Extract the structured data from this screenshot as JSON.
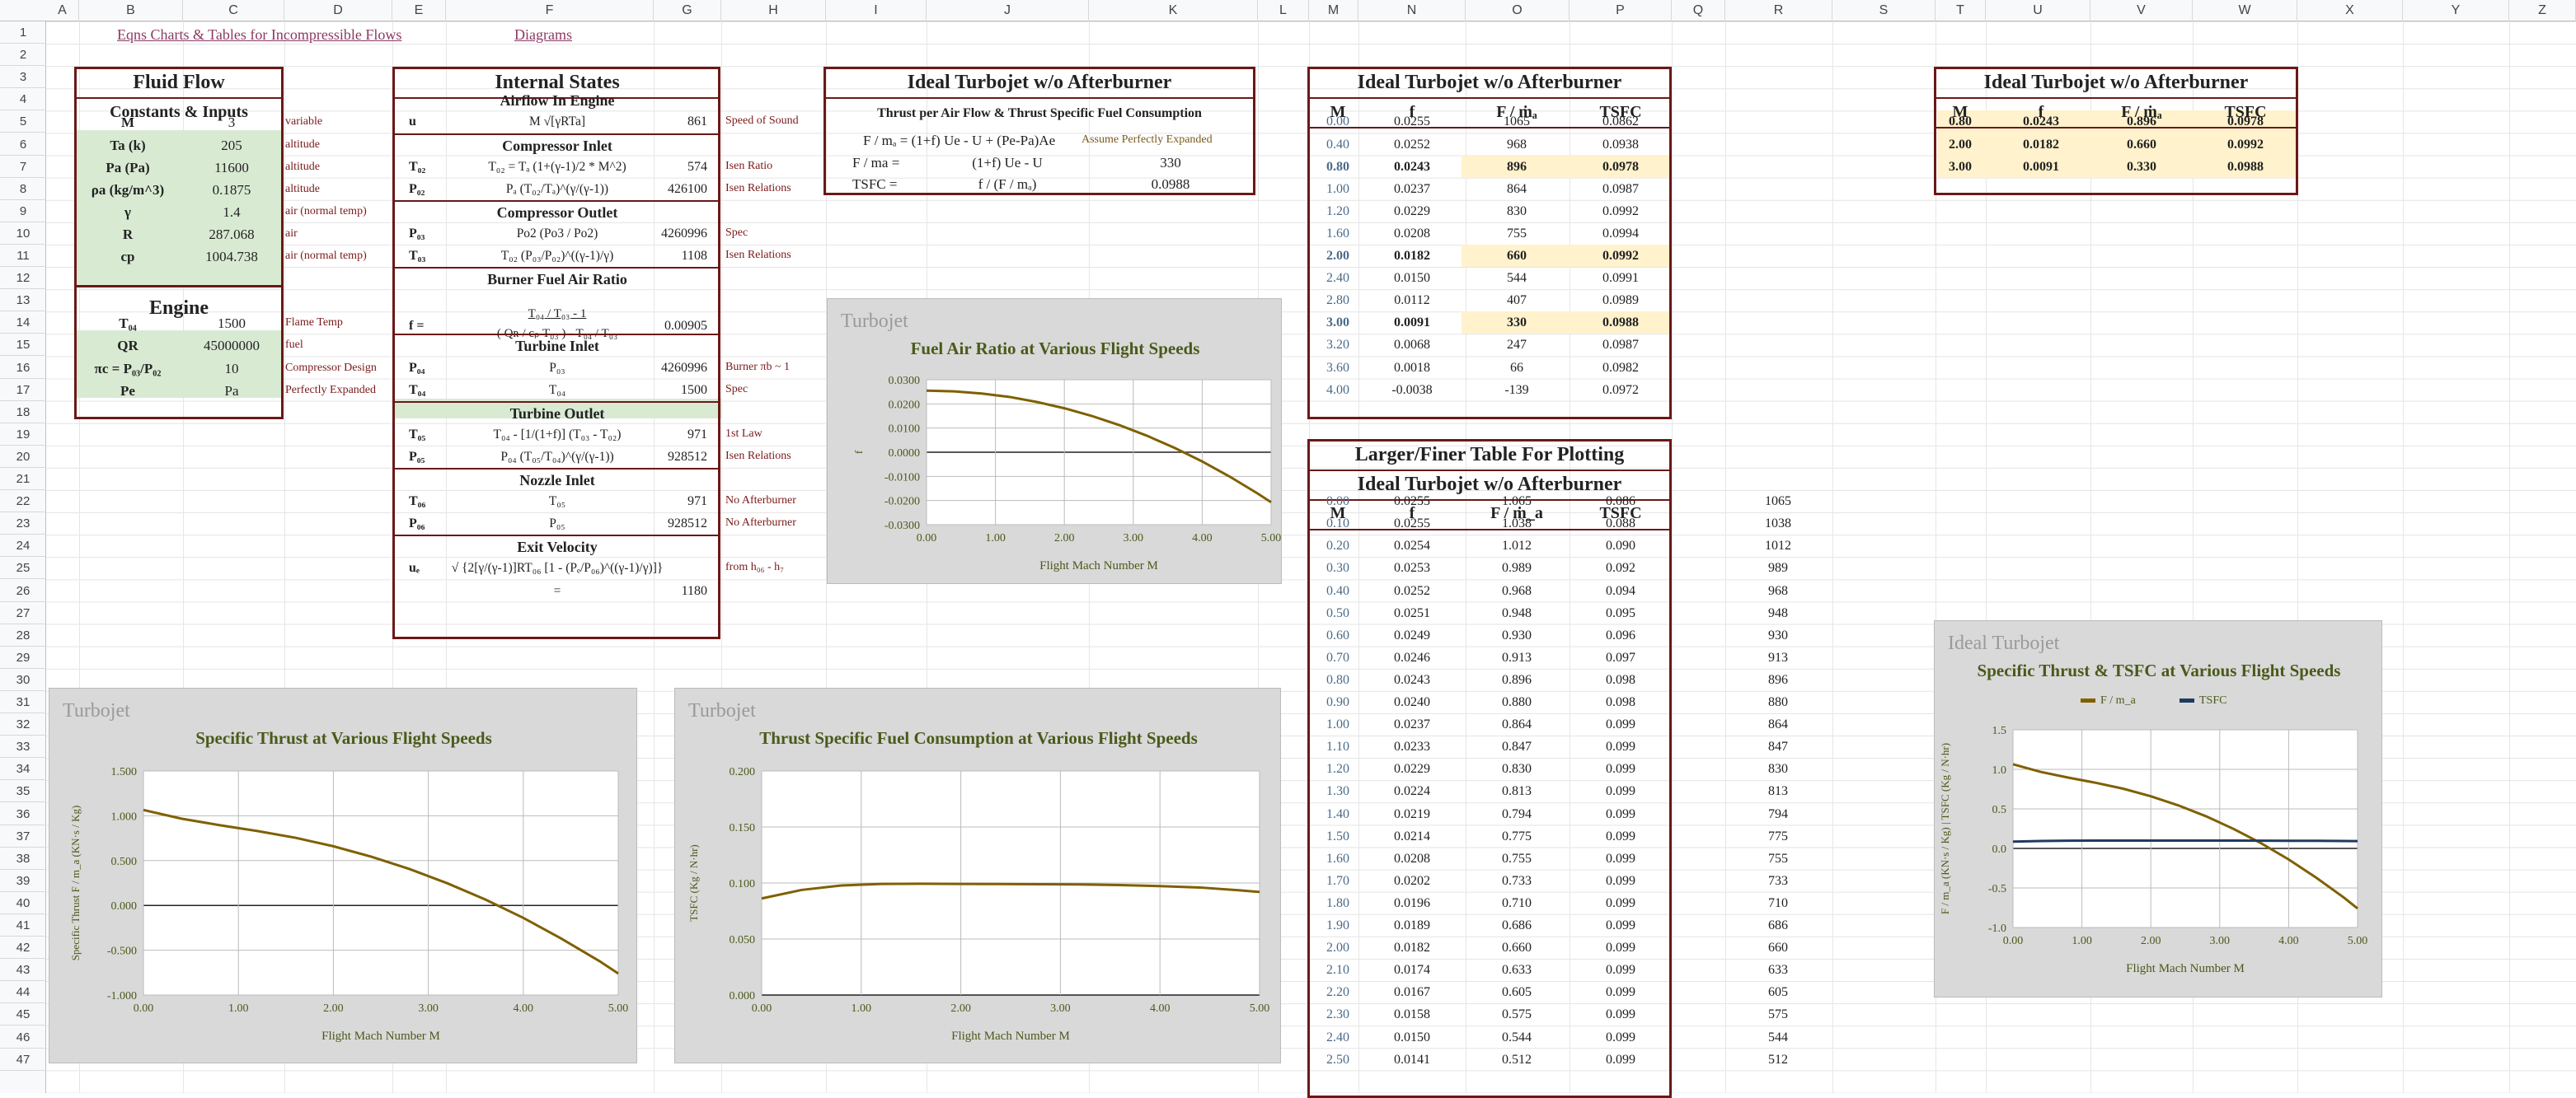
{
  "columns": [
    "A",
    "B",
    "C",
    "D",
    "E",
    "F",
    "G",
    "H",
    "I",
    "J",
    "K",
    "L",
    "M",
    "N",
    "O",
    "P",
    "Q",
    "R",
    "S",
    "T",
    "U",
    "V",
    "W",
    "X",
    "Y",
    "Z"
  ],
  "rows": [
    "1",
    "2",
    "3",
    "4",
    "5",
    "6",
    "7",
    "8",
    "9",
    "10",
    "11",
    "12",
    "13",
    "14",
    "15",
    "16",
    "17",
    "18",
    "19",
    "20",
    "21",
    "22",
    "23",
    "24",
    "25",
    "26",
    "27",
    "28",
    "29",
    "30",
    "31",
    "32",
    "33",
    "34",
    "35",
    "36",
    "37",
    "38",
    "39",
    "40",
    "41",
    "42",
    "43",
    "44",
    "45",
    "46",
    "47"
  ],
  "links": {
    "eqns": "Eqns Charts & Tables for Incompressible Flows",
    "diagrams": "Diagrams"
  },
  "fluid": {
    "title": "Fluid Flow",
    "subtitle": "Constants & Inputs",
    "rows": [
      {
        "name": "M",
        "value": "3",
        "note": "variable"
      },
      {
        "name": "Ta (k)",
        "value": "205",
        "note": "altitude"
      },
      {
        "name": "Pa (Pa)",
        "value": "11600",
        "note": "altitude"
      },
      {
        "name": "ρa (kg/m^3)",
        "value": "0.1875",
        "note": "altitude"
      },
      {
        "name": "γ",
        "value": "1.4",
        "note": "air (normal temp)"
      },
      {
        "name": "R",
        "value": "287.068",
        "note": "air"
      },
      {
        "name": "cp",
        "value": "1004.738",
        "note": "air (normal temp)"
      }
    ],
    "engine_title": "Engine",
    "engine_rows": [
      {
        "name": "T₀₄",
        "value": "1500",
        "note": "Flame Temp"
      },
      {
        "name": "QR",
        "value": "45000000",
        "note": "fuel"
      },
      {
        "name": "πc = P₀₃/P₀₂",
        "value": "10",
        "note": "Compressor Design"
      },
      {
        "name": "Pe",
        "value": "Pa",
        "note": "Perfectly Expanded"
      }
    ]
  },
  "internal": {
    "title": "Internal States",
    "sections": [
      {
        "head": "Airflow In Engine",
        "rows": [
          {
            "sym": "u",
            "eq": "M √[γRTa]",
            "val": "861",
            "note": "Speed of Sound"
          }
        ]
      },
      {
        "head": "Compressor Inlet",
        "rows": [
          {
            "sym": "T₀₂",
            "eq": "T₀₂ = Tₐ (1+(γ-1)/2 * M^2)",
            "val": "574",
            "note": "Isen Ratio"
          },
          {
            "sym": "P₀₂",
            "eq": "Pₐ (T₀₂/Tₐ)^(γ/(γ-1))",
            "val": "426100",
            "note": "Isen Relations"
          }
        ]
      },
      {
        "head": "Compressor Outlet",
        "rows": [
          {
            "sym": "P₀₃",
            "eq": "Po2 (Po3 / Po2)",
            "val": "4260996",
            "note": "Spec"
          },
          {
            "sym": "T₀₃",
            "eq": "T₀₂ (P₀₃/P₀₂)^((γ-1)/γ)",
            "val": "1108",
            "note": "Isen Relations"
          }
        ]
      },
      {
        "head": "Burner Fuel Air Ratio",
        "rows": [
          {
            "sym": "f =",
            "eq": "T₀₄ / T₀₃ - 1",
            "eq2": "( Qʀ / cₚ T₀₃ ) - T₀₄ / T₀₃",
            "val": "0.00905",
            "note": ""
          }
        ]
      },
      {
        "head": "Turbine Inlet",
        "rows": [
          {
            "sym": "P₀₄",
            "eq": "P₀₃",
            "val": "4260996",
            "note": "Burner πb ~ 1"
          },
          {
            "sym": "T₀₄",
            "eq": "T₀₄",
            "val": "1500",
            "note": "Spec"
          }
        ]
      },
      {
        "head": "Turbine Outlet",
        "rows": [
          {
            "sym": "T₀₅",
            "eq": "T₀₄ - [1/(1+f)] (T₀₃ - T₀₂)",
            "val": "971",
            "note": "1st Law"
          },
          {
            "sym": "P₀₅",
            "eq": "P₀₄ (T₀₅/T₀₄)^(γ/(γ-1))",
            "val": "928512",
            "note": "Isen Relations"
          }
        ]
      },
      {
        "head": "Nozzle Inlet",
        "rows": [
          {
            "sym": "T₀₆",
            "eq": "T₀₅",
            "val": "971",
            "note": "No Afterburner"
          },
          {
            "sym": "P₀₆",
            "eq": "P₀₅",
            "val": "928512",
            "note": "No Afterburner"
          }
        ]
      },
      {
        "head": "Exit Velocity",
        "rows": [
          {
            "sym": "uₑ",
            "eq": "√ {2[γ/(γ-1)]RT₀₆ [1 - (Pₑ/P₀₆)^((γ-1)/γ)]}",
            "val": "",
            "note": "from h₀₆ - h₇"
          },
          {
            "sym": "",
            "eq": "=",
            "val": "1180",
            "note": ""
          }
        ]
      }
    ]
  },
  "thrust_box": {
    "title": "Ideal Turbojet w/o Afterburner",
    "subtitle": "Thrust per Air Flow & Thrust Specific Fuel Consumption",
    "l1": "F / mₐ = (1+f) Ue  -  U  +  (Pe-Pa)Ae",
    "l1note": "Assume Perfectly Expanded",
    "l2a": "F / ma =",
    "l2b": "(1+f) Ue  -  U",
    "l2v": "330",
    "l3a": "TSFC =",
    "l3b": "f / (F / mₐ)",
    "l3v": "0.0988"
  },
  "table_main": {
    "title": "Ideal Turbojet w/o Afterburner",
    "headers": [
      "M",
      "f",
      "F / ṁₐ",
      "TSFC"
    ],
    "rows": [
      [
        "0.00",
        "0.0255",
        "1065",
        "0.0862"
      ],
      [
        "0.40",
        "0.0252",
        "968",
        "0.0938"
      ],
      [
        "0.80",
        "0.0243",
        "896",
        "0.0978"
      ],
      [
        "1.00",
        "0.0237",
        "864",
        "0.0987"
      ],
      [
        "1.20",
        "0.0229",
        "830",
        "0.0992"
      ],
      [
        "1.60",
        "0.0208",
        "755",
        "0.0994"
      ],
      [
        "2.00",
        "0.0182",
        "660",
        "0.0992"
      ],
      [
        "2.40",
        "0.0150",
        "544",
        "0.0991"
      ],
      [
        "2.80",
        "0.0112",
        "407",
        "0.0989"
      ],
      [
        "3.00",
        "0.0091",
        "330",
        "0.0988"
      ],
      [
        "3.20",
        "0.0068",
        "247",
        "0.0987"
      ],
      [
        "3.60",
        "0.0018",
        "66",
        "0.0982"
      ],
      [
        "4.00",
        "-0.0038",
        "-139",
        "0.0972"
      ]
    ]
  },
  "table_right": {
    "title": "Ideal Turbojet w/o Afterburner",
    "headers": [
      "M",
      "f",
      "F / ṁₐ",
      "TSFC"
    ],
    "rows": [
      [
        "0.80",
        "0.0243",
        "0.896",
        "0.0978"
      ],
      [
        "2.00",
        "0.0182",
        "0.660",
        "0.0992"
      ],
      [
        "3.00",
        "0.0091",
        "0.330",
        "0.0988"
      ]
    ]
  },
  "table_plot": {
    "title1": "Larger/Finer Table For Plotting",
    "title2": "Ideal Turbojet w/o Afterburner",
    "headers": [
      "M",
      "f",
      "F / ṁ_a",
      "TSFC"
    ],
    "rows": [
      [
        "0.00",
        "0.0255",
        "1.065",
        "0.086",
        "1065"
      ],
      [
        "0.10",
        "0.0255",
        "1.038",
        "0.088",
        "1038"
      ],
      [
        "0.20",
        "0.0254",
        "1.012",
        "0.090",
        "1012"
      ],
      [
        "0.30",
        "0.0253",
        "0.989",
        "0.092",
        "989"
      ],
      [
        "0.40",
        "0.0252",
        "0.968",
        "0.094",
        "968"
      ],
      [
        "0.50",
        "0.0251",
        "0.948",
        "0.095",
        "948"
      ],
      [
        "0.60",
        "0.0249",
        "0.930",
        "0.096",
        "930"
      ],
      [
        "0.70",
        "0.0246",
        "0.913",
        "0.097",
        "913"
      ],
      [
        "0.80",
        "0.0243",
        "0.896",
        "0.098",
        "896"
      ],
      [
        "0.90",
        "0.0240",
        "0.880",
        "0.098",
        "880"
      ],
      [
        "1.00",
        "0.0237",
        "0.864",
        "0.099",
        "864"
      ],
      [
        "1.10",
        "0.0233",
        "0.847",
        "0.099",
        "847"
      ],
      [
        "1.20",
        "0.0229",
        "0.830",
        "0.099",
        "830"
      ],
      [
        "1.30",
        "0.0224",
        "0.813",
        "0.099",
        "813"
      ],
      [
        "1.40",
        "0.0219",
        "0.794",
        "0.099",
        "794"
      ],
      [
        "1.50",
        "0.0214",
        "0.775",
        "0.099",
        "775"
      ],
      [
        "1.60",
        "0.0208",
        "0.755",
        "0.099",
        "755"
      ],
      [
        "1.70",
        "0.0202",
        "0.733",
        "0.099",
        "733"
      ],
      [
        "1.80",
        "0.0196",
        "0.710",
        "0.099",
        "710"
      ],
      [
        "1.90",
        "0.0189",
        "0.686",
        "0.099",
        "686"
      ],
      [
        "2.00",
        "0.0182",
        "0.660",
        "0.099",
        "660"
      ],
      [
        "2.10",
        "0.0174",
        "0.633",
        "0.099",
        "633"
      ],
      [
        "2.20",
        "0.0167",
        "0.605",
        "0.099",
        "605"
      ],
      [
        "2.30",
        "0.0158",
        "0.575",
        "0.099",
        "575"
      ],
      [
        "2.40",
        "0.0150",
        "0.544",
        "0.099",
        "544"
      ],
      [
        "2.50",
        "0.0141",
        "0.512",
        "0.099",
        "512"
      ]
    ]
  },
  "chart_data": [
    {
      "type": "line",
      "watermark": "Turbojet",
      "title": "Fuel Air Ratio at Various Flight Speeds",
      "xlabel": "Flight Mach Number M",
      "ylabel": "f",
      "xlim": [
        0,
        5
      ],
      "ylim": [
        -0.03,
        0.03
      ],
      "xticks": [
        "0.00",
        "1.00",
        "2.00",
        "3.00",
        "4.00",
        "5.00"
      ],
      "yticks": [
        "-0.0300",
        "-0.0200",
        "-0.0100",
        "0.0000",
        "0.0100",
        "0.0200",
        "0.0300"
      ],
      "color": "#7f6000",
      "series": [
        {
          "x": [
            0,
            0.4,
            0.8,
            1.2,
            1.6,
            2.0,
            2.4,
            2.8,
            3.2,
            3.6,
            4.0,
            4.4,
            4.8,
            5.0
          ],
          "y": [
            0.0255,
            0.0252,
            0.0243,
            0.0229,
            0.0208,
            0.0182,
            0.015,
            0.0112,
            0.0068,
            0.0018,
            -0.0038,
            -0.0101,
            -0.017,
            -0.0207
          ]
        }
      ]
    },
    {
      "type": "line",
      "watermark": "Turbojet",
      "title": "Specific Thrust at Various Flight Speeds",
      "xlabel": "Flight Mach Number M",
      "ylabel": "Specific Thrust   F / m_a  (KN·s / Kg)",
      "xlim": [
        0,
        5
      ],
      "ylim": [
        -1,
        1.5
      ],
      "xticks": [
        "0.00",
        "1.00",
        "2.00",
        "3.00",
        "4.00",
        "5.00"
      ],
      "yticks": [
        "-1.000",
        "-0.500",
        "0.000",
        "0.500",
        "1.000",
        "1.500"
      ],
      "color": "#7f6000",
      "series": [
        {
          "x": [
            0,
            0.4,
            0.8,
            1.2,
            1.6,
            2.0,
            2.4,
            2.8,
            3.2,
            3.6,
            4.0,
            4.4,
            4.8,
            5.0
          ],
          "y": [
            1.065,
            0.968,
            0.896,
            0.83,
            0.755,
            0.66,
            0.544,
            0.407,
            0.247,
            0.066,
            -0.139,
            -0.37,
            -0.62,
            -0.76
          ]
        }
      ]
    },
    {
      "type": "line",
      "watermark": "Turbojet",
      "title": "Thrust Specific Fuel Consumption at Various Flight Speeds",
      "xlabel": "Flight Mach Number M",
      "ylabel": "TSFC  (Kg / N·hr)",
      "xlim": [
        0,
        5
      ],
      "ylim": [
        0,
        0.2
      ],
      "xticks": [
        "0.00",
        "1.00",
        "2.00",
        "3.00",
        "4.00",
        "5.00"
      ],
      "yticks": [
        "0.000",
        "0.050",
        "0.100",
        "0.150",
        "0.200"
      ],
      "color": "#7f6000",
      "series": [
        {
          "x": [
            0,
            0.4,
            0.8,
            1.2,
            1.6,
            2.0,
            2.4,
            2.8,
            3.2,
            3.6,
            4.0,
            4.4,
            4.8,
            5.0
          ],
          "y": [
            0.0862,
            0.0938,
            0.0978,
            0.0992,
            0.0994,
            0.0992,
            0.0991,
            0.0989,
            0.0987,
            0.0982,
            0.0972,
            0.096,
            0.0935,
            0.092
          ]
        }
      ]
    },
    {
      "type": "line",
      "watermark": "Ideal Turbojet",
      "title": "Specific Thrust & TSFC at Various Flight Speeds",
      "xlabel": "Flight Mach Number M",
      "ylabel": "F / m_a  (KN·s / Kg) | TSFC (Kg / N·hr)",
      "xlim": [
        0,
        5
      ],
      "ylim": [
        -1,
        1.5
      ],
      "xticks": [
        "0.00",
        "1.00",
        "2.00",
        "3.00",
        "4.00",
        "5.00"
      ],
      "yticks": [
        "-1.0",
        "-0.5",
        "0.0",
        "0.5",
        "1.0",
        "1.5"
      ],
      "series": [
        {
          "name": "F / m_a",
          "color": "#7f6000",
          "x": [
            0,
            0.4,
            0.8,
            1.2,
            1.6,
            2.0,
            2.4,
            2.8,
            3.2,
            3.6,
            4.0,
            4.4,
            4.8,
            5.0
          ],
          "y": [
            1.065,
            0.968,
            0.896,
            0.83,
            0.755,
            0.66,
            0.544,
            0.407,
            0.247,
            0.066,
            -0.139,
            -0.37,
            -0.62,
            -0.76
          ]
        },
        {
          "name": "TSFC",
          "color": "#1f3a5f",
          "x": [
            0,
            0.4,
            0.8,
            1.2,
            1.6,
            2.0,
            2.4,
            2.8,
            3.2,
            3.6,
            4.0,
            4.4,
            4.8,
            5.0
          ],
          "y": [
            0.086,
            0.094,
            0.098,
            0.099,
            0.099,
            0.099,
            0.099,
            0.099,
            0.099,
            0.098,
            0.097,
            0.096,
            0.094,
            0.092
          ]
        }
      ]
    }
  ]
}
